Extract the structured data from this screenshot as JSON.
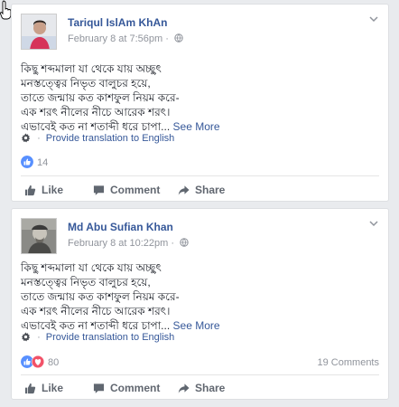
{
  "posts": [
    {
      "author": "Tariqul IslAm KhAn",
      "timestamp": "February 8 at 7:56pm",
      "privacy_icon": "globe-icon",
      "body_lines": [
        "কিছু শব্দমালা যা থেকে যায় অচ্ছুৎ",
        "মনস্তত্ত্বের নিভৃত বালুচর হয়ে,",
        "তাতে জন্মায় কত কাশফুল নিয়ম করে-",
        "এক শরৎ নীলের নীচে আরেক শরৎ।",
        "এভাবেই কত না শতাব্দী ধরে চাপা..."
      ],
      "see_more": "See More",
      "translate": "Provide translation to English",
      "reaction_types": [
        "like"
      ],
      "reaction_count": "14",
      "comment_count": "",
      "actions": {
        "like": "Like",
        "comment": "Comment",
        "share": "Share"
      }
    },
    {
      "author": "Md Abu Sufian Khan",
      "timestamp": "February 8 at 10:22pm",
      "privacy_icon": "globe-icon",
      "body_lines": [
        "কিছু শব্দমালা যা থেকে যায় অচ্ছুৎ",
        "মনস্তত্ত্বের নিভৃত বালুচর হয়ে,",
        "তাতে জন্মায় কত কাশফুল নিয়ম করে-",
        "এক শরৎ নীলের নীচে আরেক শরৎ।",
        "এভাবেই কত না শতাব্দী ধরে চাপা..."
      ],
      "see_more": "See More",
      "translate": "Provide translation to English",
      "reaction_types": [
        "like",
        "love"
      ],
      "reaction_count": "80",
      "comment_count": "19 Comments",
      "actions": {
        "like": "Like",
        "comment": "Comment",
        "share": "Share"
      }
    }
  ],
  "colors": {
    "link_blue": "#365899",
    "meta_gray": "#90949c",
    "like_blue": "#5890ff",
    "love_red": "#f25268",
    "page_bg": "#e9ebee"
  }
}
